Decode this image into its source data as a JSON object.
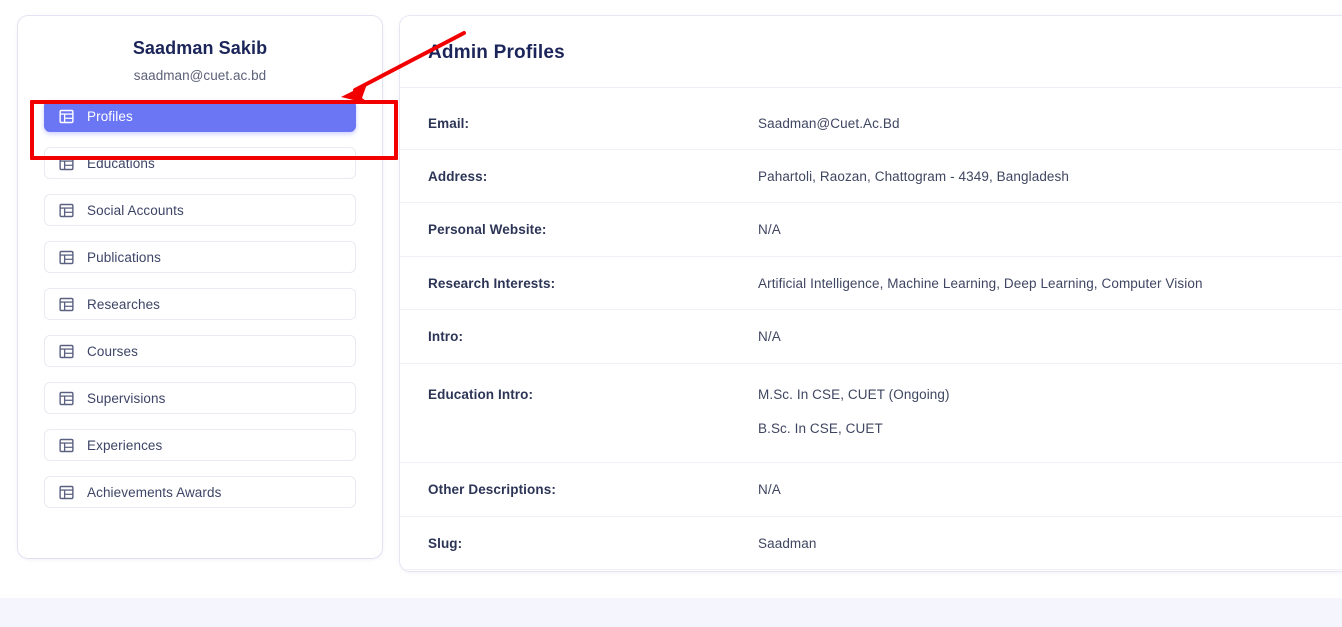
{
  "profile": {
    "name": "Saadman Sakib",
    "email": "saadman@cuet.ac.bd"
  },
  "sidebar": {
    "items": [
      {
        "label": "Profiles",
        "icon": "table-icon",
        "active": true
      },
      {
        "label": "Educations",
        "icon": "table-icon",
        "active": false
      },
      {
        "label": "Social Accounts",
        "icon": "table-icon",
        "active": false
      },
      {
        "label": "Publications",
        "icon": "table-icon",
        "active": false
      },
      {
        "label": "Researches",
        "icon": "table-icon",
        "active": false
      },
      {
        "label": "Courses",
        "icon": "table-icon",
        "active": false
      },
      {
        "label": "Supervisions",
        "icon": "table-icon",
        "active": false
      },
      {
        "label": "Experiences",
        "icon": "table-icon",
        "active": false
      },
      {
        "label": "Achievements Awards",
        "icon": "table-icon",
        "active": false
      }
    ]
  },
  "main": {
    "title": "Admin Profiles",
    "rows": [
      {
        "label": "Email:",
        "values": [
          "Saadman@Cuet.Ac.Bd"
        ]
      },
      {
        "label": "Address:",
        "values": [
          "Pahartoli, Raozan, Chattogram - 4349, Bangladesh"
        ]
      },
      {
        "label": "Personal Website:",
        "values": [
          "N/A"
        ]
      },
      {
        "label": "Research Interests:",
        "values": [
          "Artificial Intelligence, Machine Learning, Deep Learning, Computer Vision"
        ]
      },
      {
        "label": "Intro:",
        "values": [
          "N/A"
        ]
      },
      {
        "label": "Education Intro:",
        "values": [
          "M.Sc. In CSE, CUET (Ongoing)",
          "B.Sc. In CSE, CUET"
        ]
      },
      {
        "label": "Other Descriptions:",
        "values": [
          "N/A"
        ]
      },
      {
        "label": "Slug:",
        "values": [
          "Saadman"
        ]
      }
    ]
  },
  "annotations": {
    "highlight_color": "#f20000",
    "arrow_color": "#f20000",
    "target": "Profiles"
  },
  "colors": {
    "accent": "#6b76f5",
    "title": "#1b2559",
    "text": "#3f4661",
    "footer": "#f4f5fd"
  }
}
